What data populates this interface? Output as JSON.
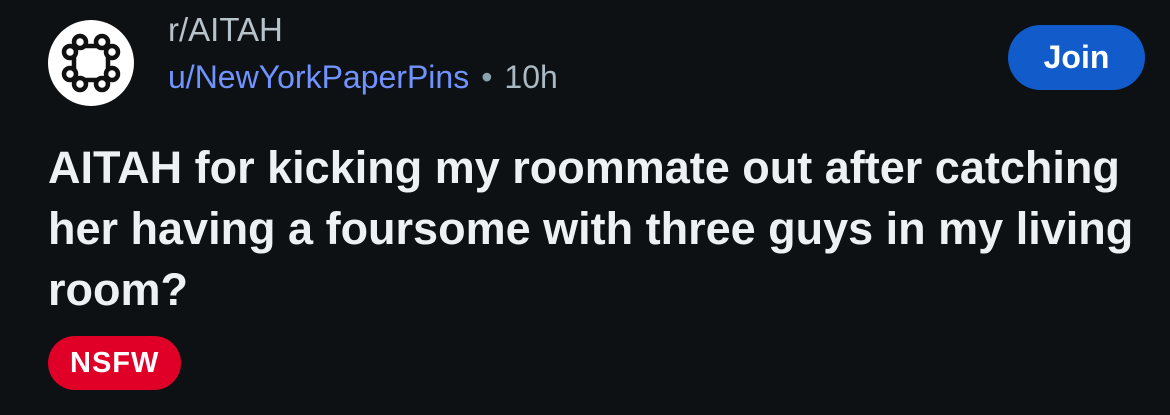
{
  "post": {
    "subreddit": "r/AITAH",
    "author": "u/NewYorkPaperPins",
    "separator": "•",
    "age": "10h",
    "join_label": "Join",
    "title": "AITAH for kicking my roommate out after catching her having a foursome with three guys in my living room?",
    "tag": "NSFW"
  },
  "colors": {
    "background": "#0e1113",
    "join": "#115bca",
    "nsfw": "#e00027",
    "username": "#7193ff"
  },
  "icons": {
    "avatar": "subreddit-node-graph-icon"
  }
}
